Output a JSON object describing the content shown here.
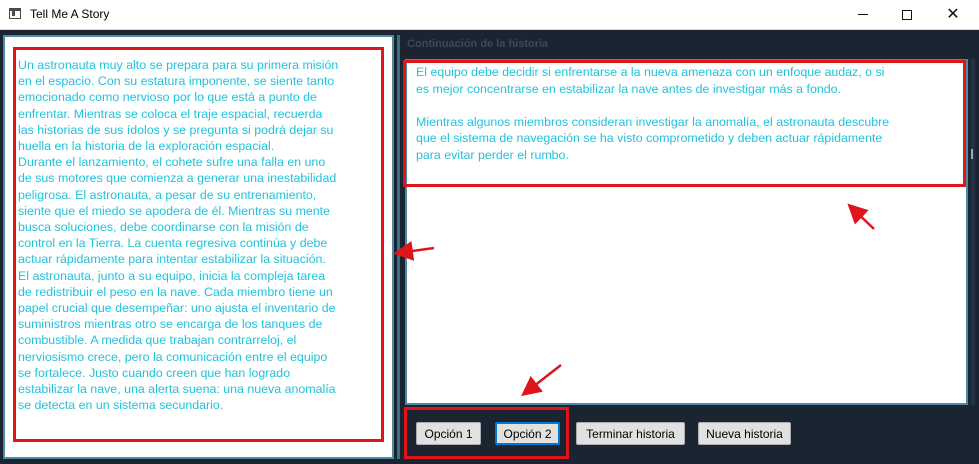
{
  "window": {
    "title": "Tell Me A Story",
    "controls": [
      "minimize-icon",
      "maximize-icon",
      "close-icon"
    ]
  },
  "story": {
    "text": "Un astronauta muy alto se prepara para su primera misión\nen el espacio. Con su estatura imponente, se siente tanto\nemocionado como nervioso por lo que está a punto de\nenfrentar. Mientras se coloca el traje espacial, recuerda\nlas historias de sus ídolos y se pregunta si podrá dejar su\nhuella en la historia de la exploración espacial.\nDurante el lanzamiento, el cohete sufre una falla en uno\nde sus motores que comienza a generar una inestabilidad\npeligrosa. El astronauta, a pesar de su entrenamiento,\nsiente que el miedo se apodera de él. Mientras su mente\nbusca soluciones, debe coordinarse con la misión de\ncontrol en la Tierra. La cuenta regresiva continúa y debe\nactuar rápidamente para intentar estabilizar la situación.\nEl astronauta, junto a su equipo, inicia la compleja tarea\nde redistribuir el peso en la nave. Cada miembro tiene un\npapel crucial que desempeñar: uno ajusta el inventario de\nsuministros mientras otro se encarga de los tanques de\ncombustible. A medida que trabajan contrarreloj, el\nnerviosismo crece, pero la comunicación entre el equipo\nse fortalece. Justo cuando creen que han logrado\nestabilizar la nave, una alerta suena: una nueva anomalía\nse detecta en un sistema secundario."
  },
  "continuation": {
    "header": "Continuación de la historia",
    "text": "El equipo debe decidir si enfrentarse a la nueva amenaza con un enfoque audaz, o si\nes mejor concentrarse en estabilizar la nave antes de investigar más a fondo.\n\nMientras algunos miembros consideran investigar la anomalía, el astronauta descubre\nque el sistema de navegación se ha visto comprometido y deben actuar rápidamente\npara evitar perder el rumbo."
  },
  "buttons": {
    "option1": "Opción 1",
    "option2": "Opción 2",
    "end_story": "Terminar historia",
    "new_story": "Nueva historia"
  },
  "colors": {
    "background": "#1b2431",
    "text_cyan": "#20c3dd",
    "highlight_red": "#e0141b",
    "focus_blue": "#0078d7"
  }
}
